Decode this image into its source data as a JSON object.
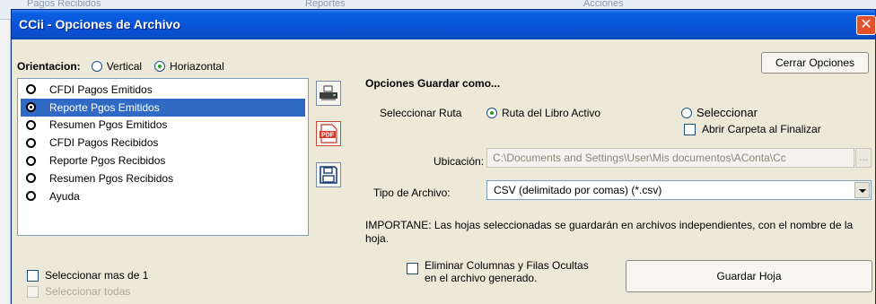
{
  "background": {
    "tabs": [
      "Pagos Recibidos",
      "Reportes",
      "Acciones"
    ]
  },
  "window": {
    "title": "CCii - Opciones de Archivo",
    "close_glyph": "✕"
  },
  "orientation": {
    "label": "Orientacion:",
    "options": [
      {
        "label": "Vertical",
        "checked": false
      },
      {
        "label": "Horiazontal",
        "checked": true
      }
    ]
  },
  "list": {
    "items": [
      {
        "label": "CFDI Pagos Emitidos",
        "checked": false,
        "selected": false
      },
      {
        "label": "Reporte Pgos Emitidos",
        "checked": true,
        "selected": true
      },
      {
        "label": "Resumen Pgos Emitidos",
        "checked": false,
        "selected": false
      },
      {
        "label": "CFDI Pagos Recibidos",
        "checked": false,
        "selected": false
      },
      {
        "label": "Reporte Pgos Recibidos",
        "checked": false,
        "selected": false
      },
      {
        "label": "Resumen Pgos Recibidos",
        "checked": false,
        "selected": false
      },
      {
        "label": "Ayuda",
        "checked": false,
        "selected": false
      }
    ]
  },
  "select_multiple": {
    "label": "Seleccionar mas de 1",
    "checked": false
  },
  "select_all": {
    "label": "Seleccionar todas",
    "checked": false,
    "disabled": true
  },
  "tools": [
    "printer-icon",
    "pdf-icon",
    "save-disk-icon"
  ],
  "tool_pdf_label": "PDF",
  "close_options_label": "Cerrar Opciones",
  "save_as": {
    "heading": "Opciones Guardar como...",
    "route_label": "Seleccionar Ruta",
    "route_active": {
      "label": "Ruta del Libro Activo",
      "checked": true
    },
    "route_select": {
      "label": "Seleccionar",
      "checked": false
    },
    "open_folder": {
      "label": "Abrir Carpeta al Finalizar",
      "checked": false
    },
    "location_label": "Ubicación:",
    "location_value": "C:\\Documents and Settings\\User\\Mis documentos\\AConta\\Cc",
    "browse_label": "...",
    "file_type_label": "Tipo de Archivo:",
    "file_type_value": "CSV (delimitado por comas) (*.csv)"
  },
  "notice": "IMPORTANE: Las hojas seleccionadas se guardarán en archivos independientes, con el nombre de la hoja.",
  "remove_hidden": {
    "label_line1": "Eliminar Columnas y Filas Ocultas",
    "label_line2": "en el archivo generado.",
    "checked": false
  },
  "save_sheet_label": "Guardar Hoja",
  "colors": {
    "title_bar": "#0854d8",
    "selection": "#316ac5",
    "dialog_bg": "#ece9d8",
    "close_button": "#e2512c"
  }
}
